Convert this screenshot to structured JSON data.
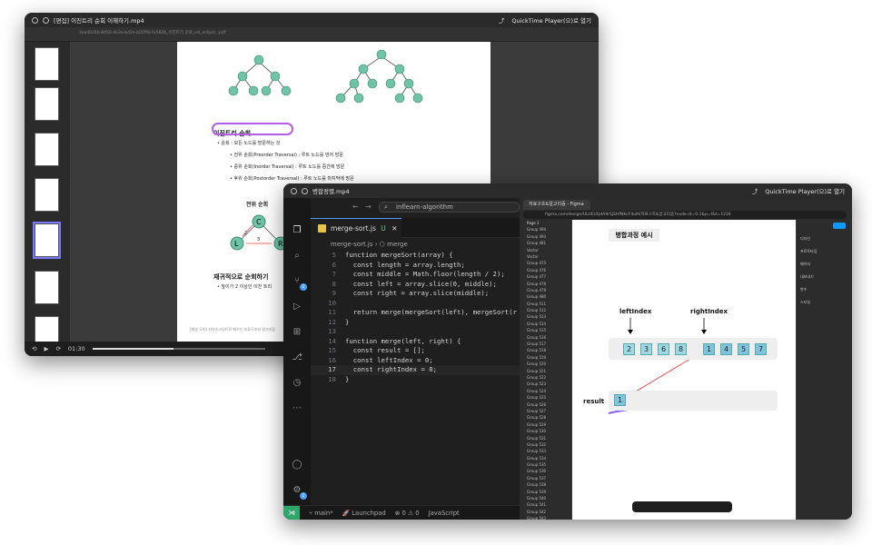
{
  "window_one": {
    "title": "[편집] 이진트리 순회 이해하기.mp4",
    "player": "QuickTime Player(으)로 열기",
    "doc_path": "3aa40d1b-8450-4e3e-bd2e-b05f5b7e583b_이진트리 순회_sol_eclipsl...pdf",
    "timecode": "01:30",
    "progress": 0.47,
    "heading": "이진트리 순회",
    "bullet_main": "순회 : 모든 노드를 방문하는 것",
    "bullets": [
      "전위 순회(Preorder Traversal) : 루트 노드를 먼저 방문",
      "중위 순회(Inorder Traversal) : 루트 노드를 중간에 방문",
      "후위 순회(Postorder Traversal) : 루트 노드를 마지막에 방문"
    ],
    "preorder_title": "전위 순회",
    "recursion_heading": "재귀적으로 순회하기",
    "recursion_bullet": "높이가 2 이상인 이진 트리",
    "footer": "[채널 도티] 자바스크립트로 배우는 자료구조와 알고리즘",
    "node_letters": [
      "C",
      "L",
      "R"
    ],
    "edge_numbers": [
      "2",
      "3"
    ]
  },
  "window_two": {
    "title": "병합정렬.mp4",
    "player": "QuickTime Player(으)로 열기",
    "search": "inflearn-algorithm",
    "tab_label": "merge-sort.js",
    "tab_status": "U",
    "breadcrumb_file": "merge-sort.js",
    "breadcrumb_symbol": "merge",
    "code_lines": [
      {
        "n": "5",
        "t": "function mergeSort(array) {"
      },
      {
        "n": "6",
        "t": "  const length = array.length;"
      },
      {
        "n": "7",
        "t": "  const middle = Math.floor(length / 2);"
      },
      {
        "n": "8",
        "t": "  const left = array.slice(0, middle);"
      },
      {
        "n": "9",
        "t": "  const right = array.slice(middle);"
      },
      {
        "n": "10",
        "t": ""
      },
      {
        "n": "11",
        "t": "  return merge(mergeSort(left), mergeSort(r"
      },
      {
        "n": "12",
        "t": "}"
      },
      {
        "n": "13",
        "t": ""
      },
      {
        "n": "14",
        "t": "function merge(left, right) {"
      },
      {
        "n": "15",
        "t": "  const result = [];"
      },
      {
        "n": "16",
        "t": "  const leftIndex = 0;"
      },
      {
        "n": "17",
        "t": "  const rightIndex = 0;"
      },
      {
        "n": "18",
        "t": "}"
      }
    ],
    "status": {
      "branch": "main*",
      "launchpad": "Launchpad",
      "errors": "0",
      "warnings": "0",
      "language": "JavaScript"
    },
    "badge_source_control": "1",
    "badge_accounts": "1"
  },
  "figma": {
    "browser_tab": "자료구조&알고리즘 - Figma",
    "url": "figma.com/design/ULUEUQdA9rSjSHfNKcF4uM/자료구조&알고리즘?node-id=0-1&p=f&t=1234",
    "page_name": "Page 1",
    "layers": [
      "Group 494",
      "Group 493",
      "Group 481",
      "Vector",
      "Vector",
      "Group 475",
      "Group 476",
      "Group 477",
      "Group 478",
      "Group 479",
      "Group 480",
      "Group 511",
      "Group 512",
      "Group 513",
      "Group 514",
      "Group 515",
      "Group 516",
      "Group 517",
      "Group 518",
      "Group 519",
      "Group 520",
      "Group 521",
      "Group 522",
      "Group 523",
      "Group 524",
      "Group 525",
      "Group 526",
      "Group 527",
      "Group 528",
      "Group 529",
      "Group 530",
      "Group 531",
      "Group 532",
      "Group 533",
      "Group 534",
      "Group 535",
      "Group 536",
      "Group 537",
      "Group 538",
      "Group 539",
      "Group 540",
      "Group 541",
      "Group 542",
      "Group 543"
    ],
    "right_panel": [
      "디자인",
      "프로토타입",
      "페이지",
      "내보내기",
      "변수",
      "스타일"
    ],
    "canvas_title": "병합과정 예시",
    "left_label": "leftIndex",
    "right_label": "rightIndex",
    "array_values": [
      "2",
      "3",
      "6",
      "8",
      "1",
      "4",
      "5",
      "7"
    ],
    "result_label": "result",
    "result_values": [
      "1"
    ]
  }
}
